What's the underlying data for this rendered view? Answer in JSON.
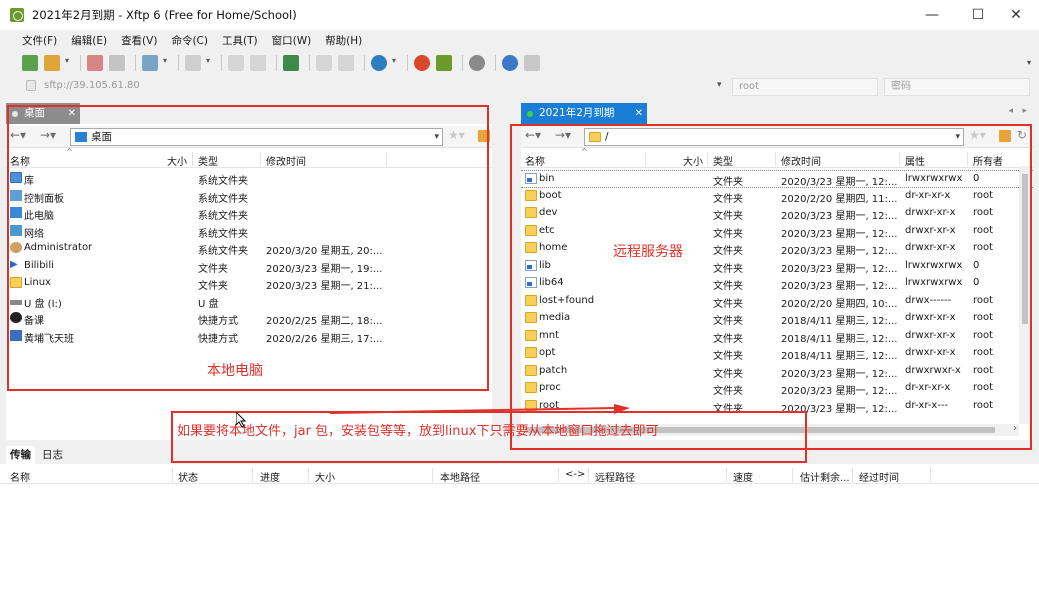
{
  "window": {
    "title": "2021年2月到期 - Xftp 6 (Free for Home/School)",
    "controls": [
      "—",
      "☐",
      "✕"
    ]
  },
  "menu": [
    "文件(F)",
    "编辑(E)",
    "查看(V)",
    "命令(C)",
    "工具(T)",
    "窗口(W)",
    "帮助(H)"
  ],
  "address": {
    "url": "sftp://39.105.61.80",
    "user_placeholder": "root",
    "password_placeholder": "密码"
  },
  "left": {
    "tab": "桌面",
    "path": "桌面",
    "columns": [
      "名称",
      "大小",
      "类型",
      "修改时间"
    ],
    "rows": [
      {
        "name": "库",
        "size": "",
        "type": "系统文件夹",
        "mtime": "",
        "icon": "library-icon"
      },
      {
        "name": "控制面板",
        "size": "",
        "type": "系统文件夹",
        "mtime": "",
        "icon": "control-panel-icon"
      },
      {
        "name": "此电脑",
        "size": "",
        "type": "系统文件夹",
        "mtime": "",
        "icon": "computer-icon"
      },
      {
        "name": "网络",
        "size": "",
        "type": "系统文件夹",
        "mtime": "",
        "icon": "network-icon"
      },
      {
        "name": "Administrator",
        "size": "",
        "type": "系统文件夹",
        "mtime": "2020/3/20 星期五, 20:...",
        "icon": "user-icon"
      },
      {
        "name": "Bilibili",
        "size": "",
        "type": "文件夹",
        "mtime": "2020/3/23 星期一, 19:...",
        "icon": "play-icon"
      },
      {
        "name": "Linux",
        "size": "",
        "type": "文件夹",
        "mtime": "2020/3/23 星期一, 21:...",
        "icon": "folder-icon"
      },
      {
        "name": "U 盘 (I:)",
        "size": "",
        "type": "U 盘",
        "mtime": "",
        "icon": "usb-drive-icon"
      },
      {
        "name": "备课",
        "size": "",
        "type": "快捷方式",
        "mtime": "2020/2/25 星期二, 18:...",
        "icon": "shortcut-icon"
      },
      {
        "name": "黄埔飞天班",
        "size": "",
        "type": "快捷方式",
        "mtime": "2020/2/26 星期三, 17:...",
        "icon": "shortcut-icon"
      }
    ]
  },
  "right": {
    "tab": "2021年2月到期",
    "path": "/",
    "columns": [
      "名称",
      "大小",
      "类型",
      "修改时间",
      "属性",
      "所有者"
    ],
    "rows": [
      {
        "name": "bin",
        "size": "",
        "type": "文件夹",
        "mtime": "2020/3/23 星期一, 12:...",
        "perm": "lrwxrwxrwx",
        "owner": "0",
        "icon": "link-icon"
      },
      {
        "name": "boot",
        "size": "",
        "type": "文件夹",
        "mtime": "2020/2/20 星期四, 11:...",
        "perm": "dr-xr-xr-x",
        "owner": "root",
        "icon": "folder-icon"
      },
      {
        "name": "dev",
        "size": "",
        "type": "文件夹",
        "mtime": "2020/3/23 星期一, 12:...",
        "perm": "drwxr-xr-x",
        "owner": "root",
        "icon": "folder-icon"
      },
      {
        "name": "etc",
        "size": "",
        "type": "文件夹",
        "mtime": "2020/3/23 星期一, 12:...",
        "perm": "drwxr-xr-x",
        "owner": "root",
        "icon": "folder-icon"
      },
      {
        "name": "home",
        "size": "",
        "type": "文件夹",
        "mtime": "2020/3/23 星期一, 12:...",
        "perm": "drwxr-xr-x",
        "owner": "root",
        "icon": "folder-icon"
      },
      {
        "name": "lib",
        "size": "",
        "type": "文件夹",
        "mtime": "2020/3/23 星期一, 12:...",
        "perm": "lrwxrwxrwx",
        "owner": "0",
        "icon": "link-icon"
      },
      {
        "name": "lib64",
        "size": "",
        "type": "文件夹",
        "mtime": "2020/3/23 星期一, 12:...",
        "perm": "lrwxrwxrwx",
        "owner": "0",
        "icon": "link-icon"
      },
      {
        "name": "lost+found",
        "size": "",
        "type": "文件夹",
        "mtime": "2020/2/20 星期四, 10:...",
        "perm": "drwx------",
        "owner": "root",
        "icon": "folder-icon"
      },
      {
        "name": "media",
        "size": "",
        "type": "文件夹",
        "mtime": "2018/4/11 星期三, 12:...",
        "perm": "drwxr-xr-x",
        "owner": "root",
        "icon": "folder-icon"
      },
      {
        "name": "mnt",
        "size": "",
        "type": "文件夹",
        "mtime": "2018/4/11 星期三, 12:...",
        "perm": "drwxr-xr-x",
        "owner": "root",
        "icon": "folder-icon"
      },
      {
        "name": "opt",
        "size": "",
        "type": "文件夹",
        "mtime": "2018/4/11 星期三, 12:...",
        "perm": "drwxr-xr-x",
        "owner": "root",
        "icon": "folder-icon"
      },
      {
        "name": "patch",
        "size": "",
        "type": "文件夹",
        "mtime": "2020/3/23 星期一, 12:...",
        "perm": "drwxrwxr-x",
        "owner": "root",
        "icon": "folder-icon"
      },
      {
        "name": "proc",
        "size": "",
        "type": "文件夹",
        "mtime": "2020/3/23 星期一, 12:...",
        "perm": "dr-xr-xr-x",
        "owner": "root",
        "icon": "folder-icon"
      },
      {
        "name": "root",
        "size": "",
        "type": "文件夹",
        "mtime": "2020/3/23 星期一, 12:...",
        "perm": "dr-xr-x---",
        "owner": "root",
        "icon": "folder-icon"
      }
    ]
  },
  "transfer": {
    "tabs": [
      "传输",
      "日志"
    ],
    "columns": [
      "名称",
      "状态",
      "进度",
      "大小",
      "本地路径",
      "<->",
      "远程路径",
      "速度",
      "估计剩余...",
      "经过时间"
    ]
  },
  "annotations": {
    "local": "本地电脑",
    "remote": "远程服务器",
    "hint": "如果要将本地文件，jar 包，安装包等等，放到linux下只需要从本地窗口拖过去即可"
  },
  "colors": {
    "annotation_red": "#e0302a",
    "active_tab_blue": "#1a7fd4",
    "folder_yellow": "#f7cf5a"
  }
}
